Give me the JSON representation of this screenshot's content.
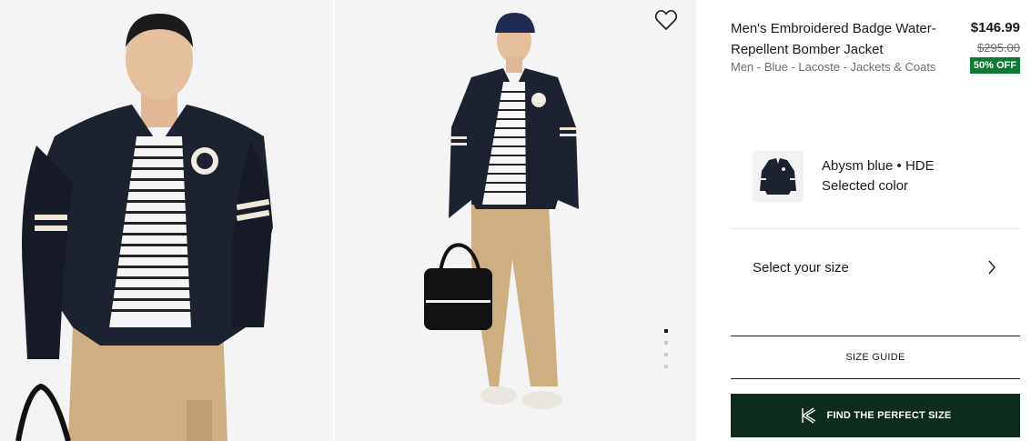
{
  "product": {
    "title": "Men's Embroidered Badge Water-Repellent Bomber Jacket",
    "breadcrumb": "Men - Blue - Lacoste - Jackets & Coats",
    "price": "$146.99",
    "old_price": "$295.00",
    "discount": "50% OFF"
  },
  "color": {
    "name": "Abysm blue • HDE",
    "caption": "Selected color"
  },
  "size": {
    "label": "Select your size"
  },
  "actions": {
    "size_guide": "SIZE GUIDE",
    "find_size": "FIND THE PERFECT SIZE"
  },
  "gallery": {
    "dots_count": 4,
    "active_dot": 1
  },
  "icons": {
    "wishlist": "heart-icon",
    "chevron": "chevron-right-icon",
    "fit": "kiwi-logo-icon"
  },
  "colors": {
    "accent_dark": "#0d2c1c",
    "discount_bg": "#0c7a33",
    "jacket": "#1c2230",
    "pants": "#cfae82"
  }
}
